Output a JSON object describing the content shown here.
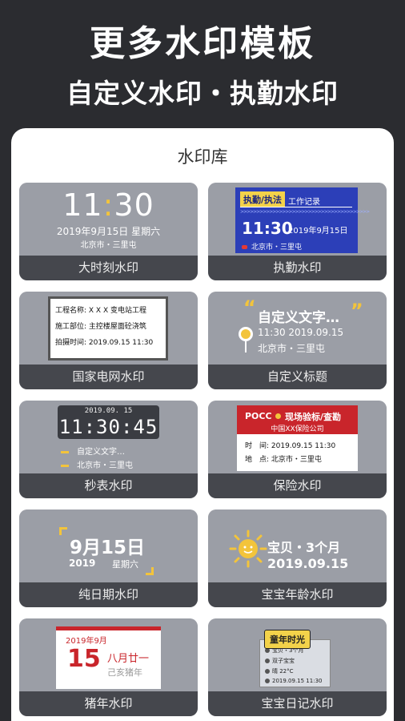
{
  "hero": {
    "title": "更多水印模板",
    "subtitle": "自定义水印・执勤水印"
  },
  "library": {
    "title": "水印库"
  },
  "cards": [
    {
      "label": "大时刻水印",
      "time_h": "11",
      "time_colon": ":",
      "time_m": "30",
      "date": "2019年9月15日  星期六",
      "location": "北京市・三里屯"
    },
    {
      "label": "执勤水印",
      "badge": "执勤/执法",
      "record": "工作记录",
      "arrows": ">>>>>>>>>>>>>>>>>>>>>>>>>>>>>>>>>>>>>>>>",
      "time": "11:30",
      "date": "2019年9月15日",
      "location": "北京市・三里屯"
    },
    {
      "label": "国家电网水印",
      "rows": [
        "工程名称: X X X 变电站工程",
        "施工部位: 主控楼屋面砼浇筑",
        "拍摄时间: 2019.09.15 11:30"
      ]
    },
    {
      "label": "自定义标题",
      "quote_open": "“",
      "quote_close": "”",
      "text": "自定义文字…",
      "time": "11:30  2019.09.15",
      "location": "北京市・三里屯"
    },
    {
      "label": "秒表水印",
      "date": "2019.09. 15",
      "time": "11:30:45",
      "row1": "自定义文字…",
      "row2": "北京市・三里屯"
    },
    {
      "label": "保险水印",
      "pocc": "POCC",
      "title": "现场验标/查勘",
      "company": "中国XX保险公司",
      "row1": "时　间: 2019.09.15 11:30",
      "row2": "地　点: 北京市・三里屯"
    },
    {
      "label": "纯日期水印",
      "date": "9月15日",
      "year": "2019",
      "weekday": "星期六"
    },
    {
      "label": "宝宝年龄水印",
      "text": "宝贝・3个月",
      "date": "2019.09.15"
    },
    {
      "label": "猪年水印",
      "year_month": "2019年9月",
      "day": "15",
      "lunar": "八月廿一",
      "ganzhi": "己亥猪年"
    },
    {
      "label": "宝宝日记水印",
      "badge": "童年时光",
      "rows": [
        "宝贝・3个月",
        "双子宝宝",
        "晴 22°C",
        "2019.09.15 11:30"
      ]
    }
  ],
  "colors": {
    "accent": "#f3c43b",
    "background": "#2b2c30",
    "card_label_bg": "#45474d",
    "duty_blue": "#2c3fb8",
    "red": "#c9252b"
  }
}
